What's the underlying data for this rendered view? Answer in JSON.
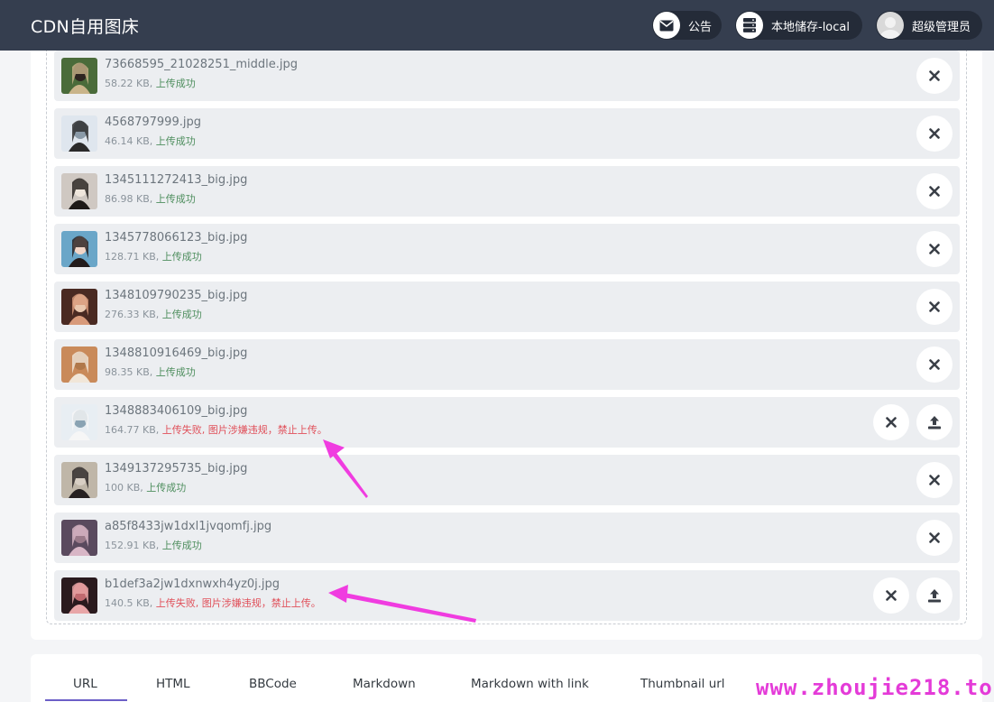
{
  "header": {
    "brand": "CDN自用图床",
    "notice_label": "公告",
    "storage_label": "本地储存-local",
    "user_label": "超级管理员"
  },
  "files": [
    {
      "name": "73668595_21028251_middle.jpg",
      "size": "58.22 KB,",
      "status": "上传成功",
      "state": "ok"
    },
    {
      "name": "4568797999.jpg",
      "size": "46.14 KB,",
      "status": "上传成功",
      "state": "ok"
    },
    {
      "name": "1345111272413_big.jpg",
      "size": "86.98 KB,",
      "status": "上传成功",
      "state": "ok"
    },
    {
      "name": "1345778066123_big.jpg",
      "size": "128.71 KB,",
      "status": "上传成功",
      "state": "ok"
    },
    {
      "name": "1348109790235_big.jpg",
      "size": "276.33 KB,",
      "status": "上传成功",
      "state": "ok"
    },
    {
      "name": "1348810916469_big.jpg",
      "size": "98.35 KB,",
      "status": "上传成功",
      "state": "ok"
    },
    {
      "name": "1348883406109_big.jpg",
      "size": "164.77 KB,",
      "status": "上传失败, 图片涉嫌违规，禁止上传。",
      "state": "fail"
    },
    {
      "name": "1349137295735_big.jpg",
      "size": "100 KB,",
      "status": "上传成功",
      "state": "ok"
    },
    {
      "name": "a85f8433jw1dxl1jvqomfj.jpg",
      "size": "152.91 KB,",
      "status": "上传成功",
      "state": "ok"
    },
    {
      "name": "b1def3a2jw1dxnwxh4yz0j.jpg",
      "size": "140.5 KB,",
      "status": "上传失败, 图片涉嫌违规，禁止上传。",
      "state": "fail"
    }
  ],
  "tabs": [
    "URL",
    "HTML",
    "BBCode",
    "Markdown",
    "Markdown with link",
    "Thumbnail url"
  ],
  "active_tab": "URL",
  "watermark": "www.zhoujie218.top",
  "colors": {
    "header_bg": "#353e4f",
    "row_bg": "#eceef1",
    "success": "#4e8e5e",
    "fail": "#e0505a",
    "annotation": "#f03ce0",
    "tab_underline": "#6c5fc7"
  },
  "icons": {
    "notice": "envelope-icon",
    "storage": "server-icon",
    "remove": "close-icon",
    "retry": "upload-icon"
  }
}
